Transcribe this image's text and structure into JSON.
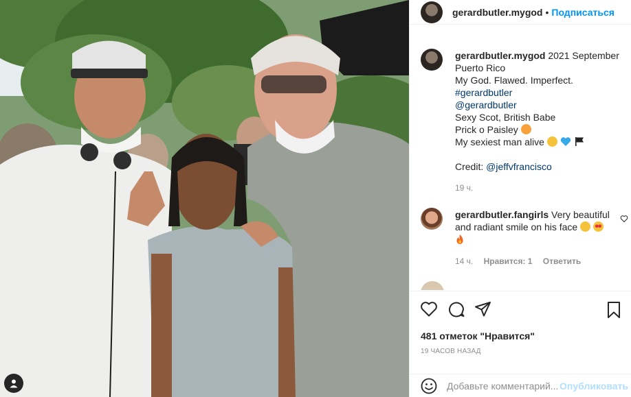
{
  "post": {
    "username": "gerardbutler.mygod",
    "follow_label": "Подписаться",
    "separator": "•"
  },
  "caption": {
    "username": "gerardbutler.mygod",
    "lines": [
      "2021 September",
      "Puerto Rico",
      "My God. Flawed. Imperfect.",
      "#gerardbutler",
      "@gerardbutler",
      "Sexy Scot, British Babe",
      "Prick o Paisley",
      "My sexiest man alive",
      "Credit:",
      "@jeffvfrancisco"
    ],
    "time": "19 ч."
  },
  "comments": [
    {
      "username": "gerardbutler.fangirls",
      "text_line1": "Very beautiful",
      "text_line2": "and radiant smile on his face",
      "time": "14 ч.",
      "likes": "Нравится: 1",
      "reply": "Ответить"
    }
  ],
  "actions": {
    "likes": "481 отметок \"Нравится\"",
    "timestamp": "19 ЧАСОВ НАЗАД",
    "comment_placeholder": "Добавьте комментарий...",
    "publish_label": "Опубликовать"
  },
  "icons": {
    "like": "heart-icon",
    "comment": "comment-icon",
    "share": "share-icon",
    "save": "bookmark-icon",
    "emoji": "emoji-icon",
    "user_tag": "user-tag-icon"
  },
  "colors": {
    "accent": "#0095f6",
    "link": "#00376b",
    "muted": "#8e8e8e",
    "publish_disabled": "#b2dffc"
  }
}
